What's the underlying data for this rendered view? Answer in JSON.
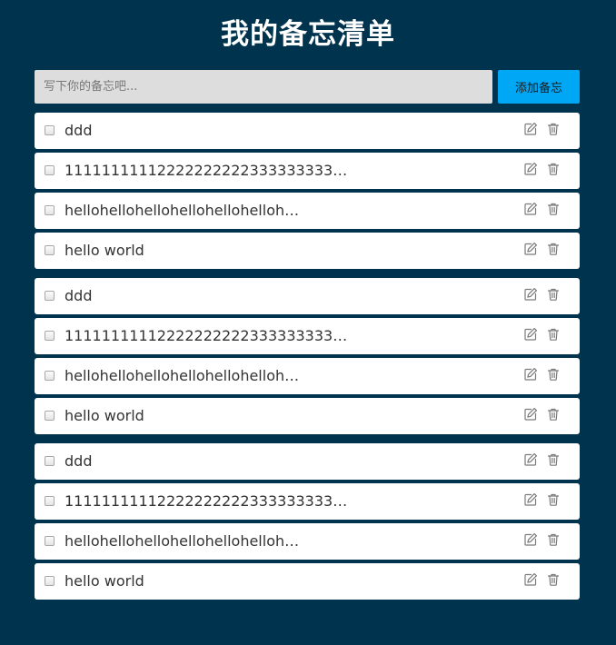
{
  "header": {
    "title": "我的备忘清单"
  },
  "input": {
    "placeholder": "写下你的备忘吧...",
    "value": "",
    "add_label": "添加备忘"
  },
  "groups": [
    {
      "items": [
        {
          "text": "ddd",
          "checked": false
        },
        {
          "text": "11111111112222222222333333333…",
          "checked": false
        },
        {
          "text": "hellohellohellohellohellohelloh…",
          "checked": false
        },
        {
          "text": "hello world",
          "checked": false
        }
      ]
    },
    {
      "items": [
        {
          "text": "ddd",
          "checked": false
        },
        {
          "text": "11111111112222222222333333333…",
          "checked": false
        },
        {
          "text": "hellohellohellohellohellohelloh…",
          "checked": false
        },
        {
          "text": "hello world",
          "checked": false
        }
      ]
    },
    {
      "items": [
        {
          "text": "ddd",
          "checked": false
        },
        {
          "text": "11111111112222222222333333333…",
          "checked": false
        },
        {
          "text": "hellohellohellohellohellohelloh…",
          "checked": false
        },
        {
          "text": "hello world",
          "checked": false
        }
      ]
    }
  ],
  "icons": {
    "edit": "edit-icon",
    "delete": "trash-icon"
  },
  "colors": {
    "background": "#00334d",
    "input_background": "#dddddd",
    "accent": "#00a7f5",
    "item_background": "#ffffff",
    "icon": "#777777"
  }
}
